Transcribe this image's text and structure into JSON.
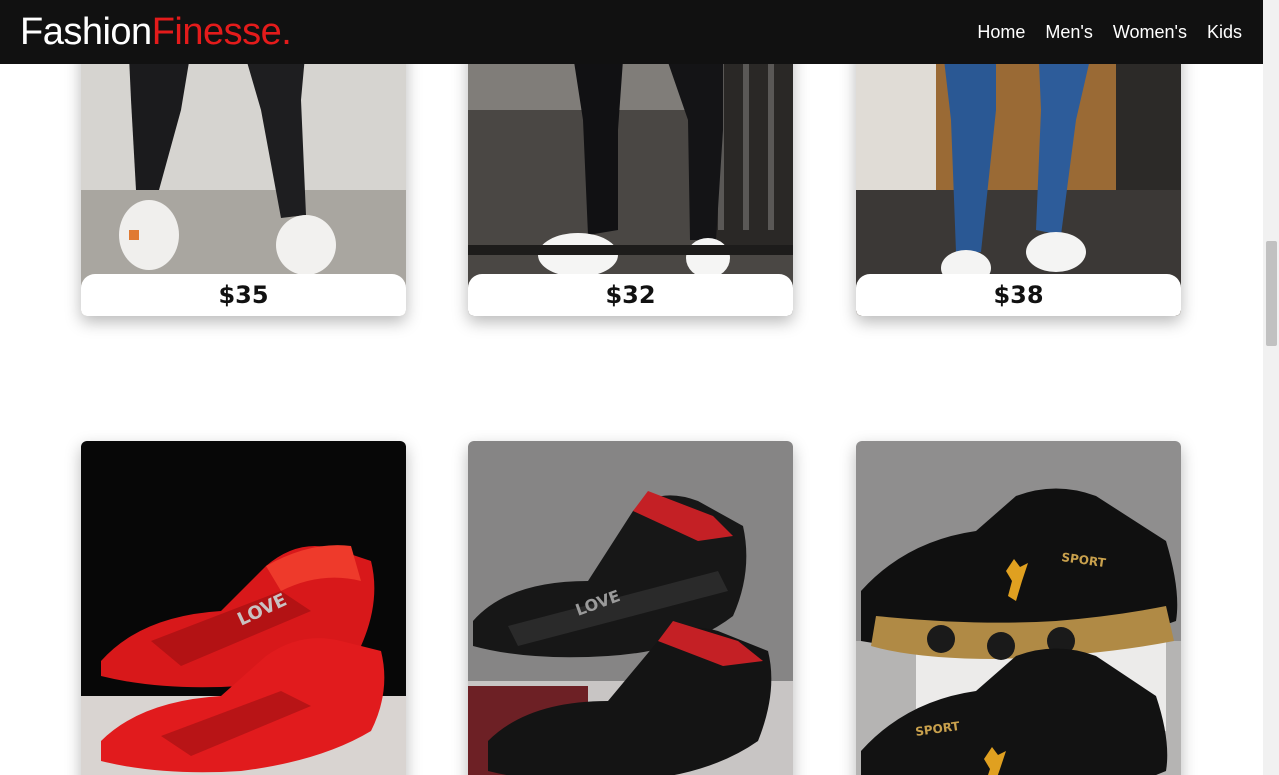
{
  "brand": {
    "name_part1": "Fashion",
    "name_part2": "Finesse."
  },
  "nav": {
    "items": [
      "Home",
      "Men's",
      "Women's",
      "Kids"
    ]
  },
  "products_top": [
    {
      "price": "$35",
      "image": "black-jeans-white-sneakers-photo"
    },
    {
      "price": "$32",
      "image": "black-jeans-white-sneakers-photo"
    },
    {
      "price": "$38",
      "image": "blue-jeans-white-sneakers-photo"
    }
  ],
  "products_bottom": [
    {
      "image": "red-sneakers-photo"
    },
    {
      "image": "black-red-sneakers-photo"
    },
    {
      "image": "black-gold-sport-sneakers-photo",
      "shoe_text": "SPORT"
    }
  ],
  "colors": {
    "nav_bg": "#111111",
    "accent": "#e41b1b"
  }
}
